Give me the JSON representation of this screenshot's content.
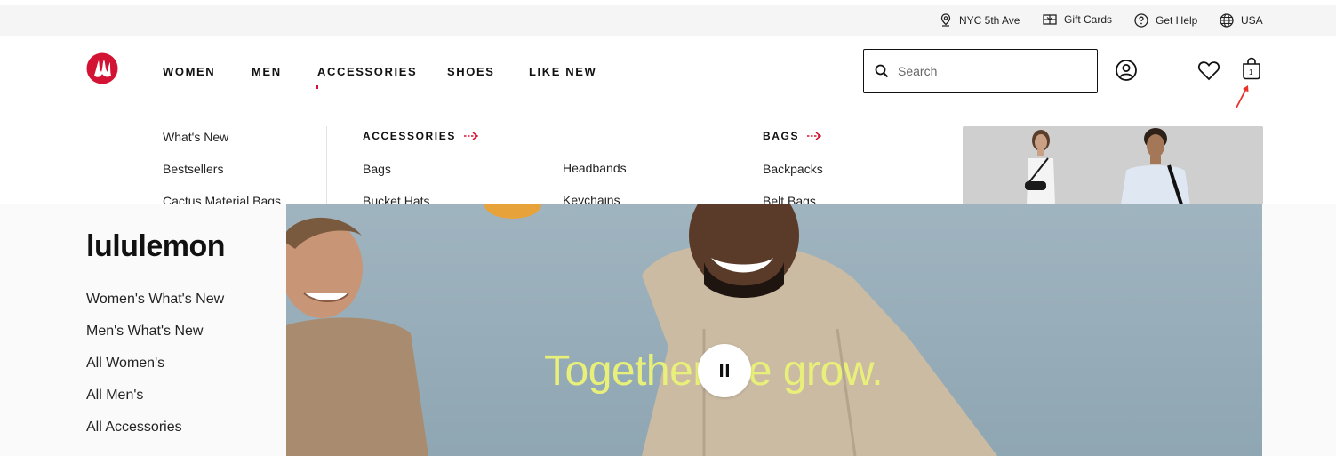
{
  "utility_bar": {
    "store": "NYC 5th Ave",
    "gift_cards": "Gift Cards",
    "help": "Get Help",
    "region": "USA"
  },
  "nav": {
    "items": [
      "WOMEN",
      "MEN",
      "ACCESSORIES",
      "SHOES",
      "LIKE NEW"
    ],
    "active": "ACCESSORIES"
  },
  "search": {
    "placeholder": "Search"
  },
  "bag": {
    "count": "1"
  },
  "menu": {
    "featured": [
      "What's New",
      "Bestsellers",
      "Cactus Material Bags"
    ],
    "accessories_heading": "ACCESSORIES",
    "accessories_col1": [
      "Bags",
      "Bucket Hats"
    ],
    "accessories_col2": [
      "Headbands",
      "Keychains"
    ],
    "bags_heading": "BAGS",
    "bags": [
      "Backpacks",
      "Belt Bags"
    ]
  },
  "sidebar": {
    "title": "lululemon",
    "links": [
      "Women's What's New",
      "Men's What's New",
      "All Women's",
      "All Men's",
      "All Accessories"
    ]
  },
  "hero": {
    "headline": "Together we grow."
  },
  "colors": {
    "brand_red": "#d31334",
    "hero_text": "#e9f07a",
    "annotation_arrow": "#e8332a"
  }
}
